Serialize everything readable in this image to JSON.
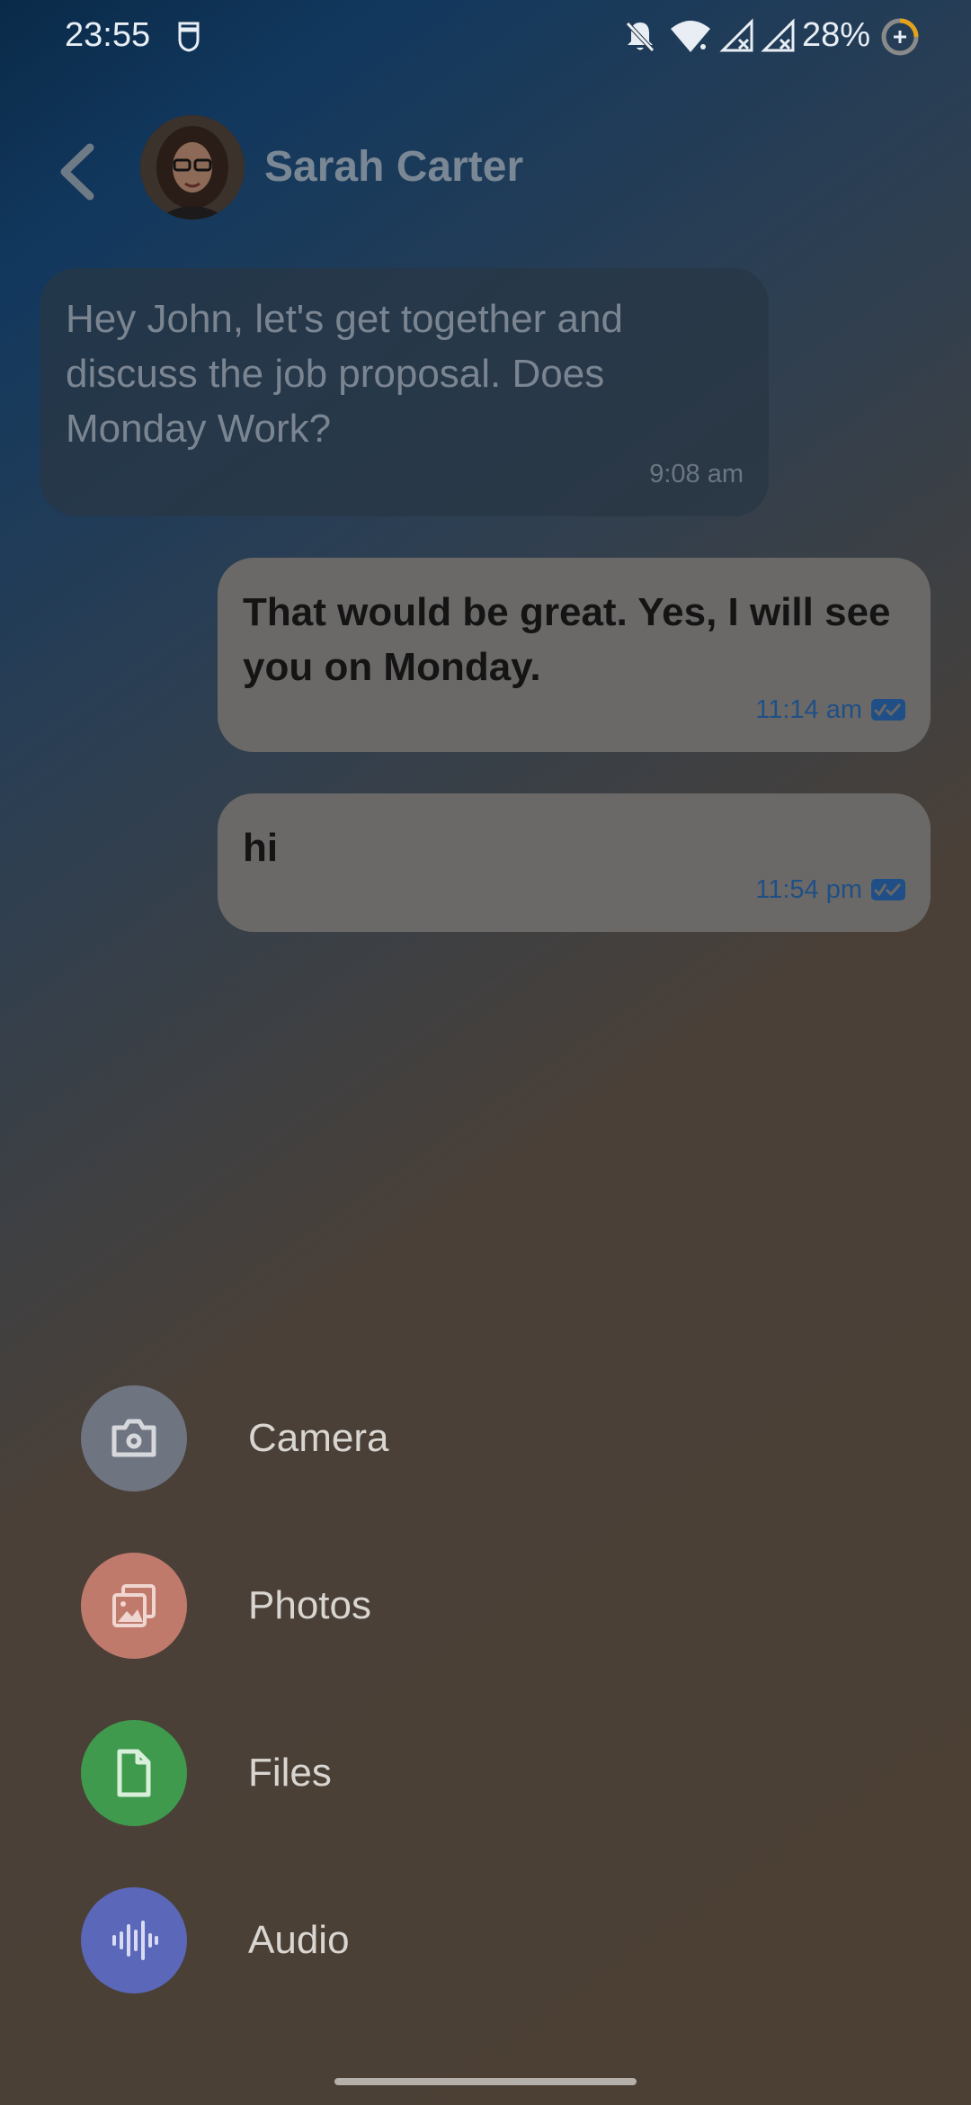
{
  "status_bar": {
    "time": "23:55",
    "battery_percent": "28%",
    "icons": [
      "privacy-icon",
      "notifications-off-icon",
      "wifi-icon",
      "signal-no-data-icon",
      "signal-no-data-icon",
      "battery-saver-icon"
    ]
  },
  "header": {
    "contact_name": "Sarah Carter",
    "back_icon": "chevron-left-icon",
    "avatar": "contact-avatar"
  },
  "messages": [
    {
      "direction": "incoming",
      "text": "Hey John, let's get together and discuss the job proposal. Does Monday Work?",
      "time": "9:08 am"
    },
    {
      "direction": "outgoing",
      "text": "That would be great. Yes, I will see you on Monday.",
      "time": "11:14 am",
      "status_icon": "double-check-icon"
    },
    {
      "direction": "outgoing",
      "text": "hi",
      "time": "11:54 pm",
      "status_icon": "double-check-icon"
    }
  ],
  "attachment_menu": {
    "items": [
      {
        "label": "Camera",
        "icon": "camera-icon",
        "color": "#6e7480"
      },
      {
        "label": "Photos",
        "icon": "photos-icon",
        "color": "#c07a6c"
      },
      {
        "label": "Files",
        "icon": "file-icon",
        "color": "#3f9a4e"
      },
      {
        "label": "Audio",
        "icon": "audio-wave-icon",
        "color": "#5b67b8"
      }
    ]
  },
  "colors": {
    "accent_blue": "#1f4f86",
    "outgoing_bubble": "#6b6967",
    "incoming_bubble": "#28374a"
  }
}
